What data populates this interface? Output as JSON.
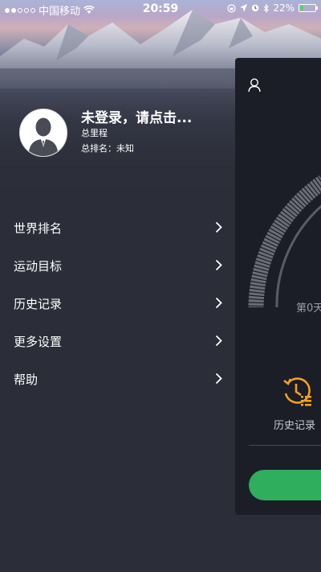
{
  "status_bar": {
    "carrier": "中国移动",
    "time": "20:59",
    "battery": "22%",
    "battery_level": 0.22
  },
  "profile": {
    "name": "未登录，请点击...",
    "total_mileage_label": "总里程",
    "total_rank_label": "总排名：未知"
  },
  "menu": {
    "items": [
      {
        "label": "世界排名"
      },
      {
        "label": "运动目标"
      },
      {
        "label": "历史记录"
      },
      {
        "label": "更多设置"
      },
      {
        "label": "帮助"
      }
    ]
  },
  "panel": {
    "day_label": "第0天",
    "history_label": "历史记录"
  },
  "colors": {
    "background": "#2b2d38",
    "panel": "#1b1d27",
    "accent_orange": "#f0a020",
    "accent_green": "#2fae5e"
  }
}
